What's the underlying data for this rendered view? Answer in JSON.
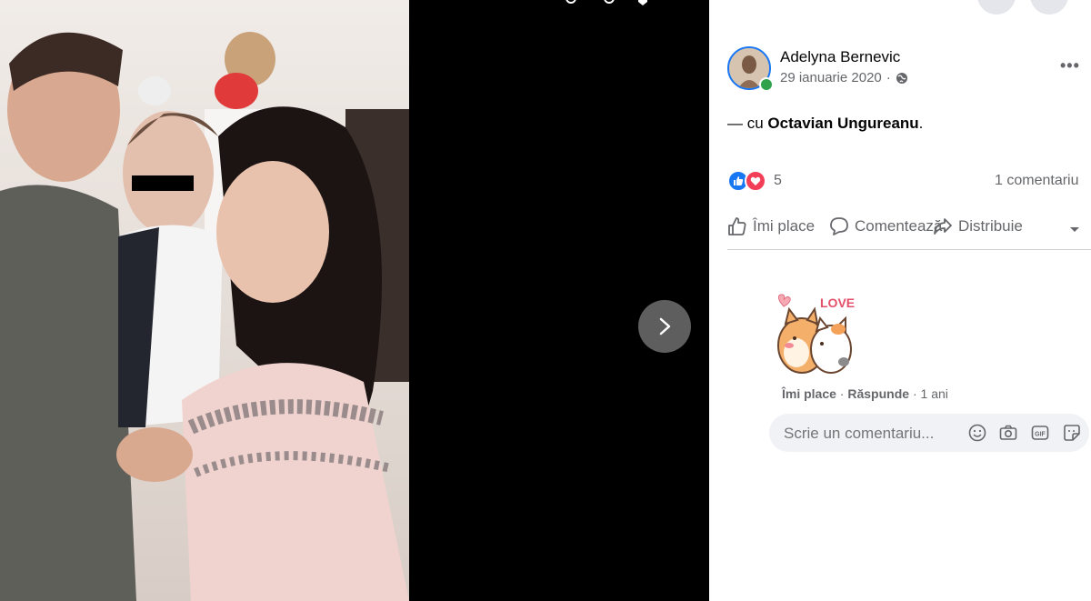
{
  "post": {
    "author": "Adelyna Bernevic",
    "date": "29 ianuarie 2020",
    "date_separator": "·",
    "caption_prefix": "— cu ",
    "tagged": "Octavian Ungureanu",
    "caption_suffix": ".",
    "reaction_count": "5",
    "comment_count": "1 comentariu"
  },
  "actions": {
    "like": "Îmi place",
    "comment": "Comentează",
    "share": "Distribuie"
  },
  "comment": {
    "sticker_text": "LOVE",
    "like": "Îmi place",
    "separator": " · ",
    "reply": "Răspunde",
    "time": "1 ani"
  },
  "composer": {
    "placeholder": "Scrie un comentariu..."
  },
  "icons": {
    "privacy": "globe-icon",
    "more": "more-options-icon",
    "next": "chevron-right-icon",
    "emoji": "emoji-icon",
    "camera": "camera-icon",
    "gif": "gif-icon",
    "sticker": "sticker-icon"
  },
  "colors": {
    "brand": "#1877f2",
    "online": "#31a24c",
    "love": "#f33e58",
    "secondary_text": "#65676b"
  }
}
